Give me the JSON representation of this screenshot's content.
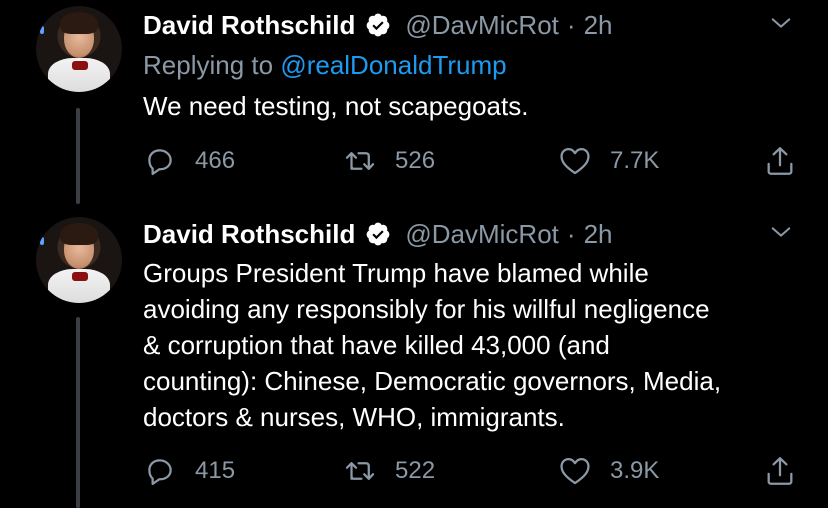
{
  "tweets": [
    {
      "author": {
        "name": "David Rothschild",
        "handle": "@DavMicRot",
        "time": "2h",
        "verified": true
      },
      "replying_prefix": "Replying to ",
      "replying_to": "@realDonaldTrump",
      "text_lines": [
        "We need testing, not scapegoats."
      ],
      "stats": {
        "replies": "466",
        "retweets": "526",
        "likes": "7.7K"
      }
    },
    {
      "author": {
        "name": "David Rothschild",
        "handle": "@DavMicRot",
        "time": "2h",
        "verified": true
      },
      "text_lines": [
        "Groups President Trump have blamed while",
        "avoiding any responsibly for his willful negligence",
        "& corruption that have killed 43,000 (and",
        "counting): Chinese, Democratic governors, Media,",
        "doctors & nurses, WHO, immigrants."
      ],
      "stats": {
        "replies": "415",
        "retweets": "522",
        "likes": "3.9K"
      }
    }
  ],
  "separator": "·",
  "icons": {
    "verified": "verified-badge-icon",
    "more": "chevron-down-icon",
    "reply": "reply-icon",
    "retweet": "retweet-icon",
    "like": "heart-icon",
    "share": "share-icon"
  },
  "colors": {
    "background": "#000000",
    "text": "#ffffff",
    "secondary": "#8b98a5",
    "link": "#1d9bf0"
  }
}
